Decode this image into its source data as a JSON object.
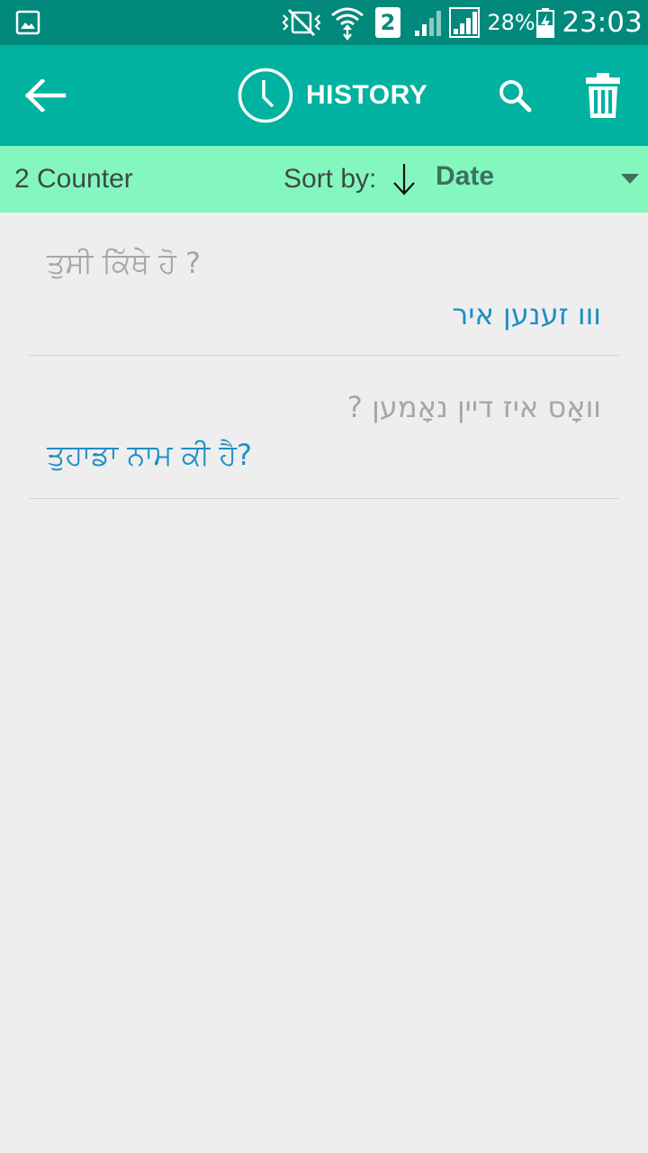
{
  "status_bar": {
    "battery_percent": "28%",
    "time": "23:03",
    "sim_badge": "2",
    "icons": [
      "gallery-notification-icon",
      "vibrate-mute-icon",
      "wifi-icon",
      "sim2-icon",
      "signal-1-icon",
      "signal-2-icon",
      "battery-charging-icon"
    ]
  },
  "toolbar": {
    "title": "HISTORY",
    "icons": [
      "back-arrow-icon",
      "clock-icon",
      "search-icon",
      "trash-icon"
    ],
    "color": "#00b29f"
  },
  "sort_bar": {
    "counter": "2 Counter",
    "sort_label": "Sort by:",
    "sort_value": "Date",
    "color": "#84f7bf"
  },
  "history": [
    {
      "source": "ਤੁਸੀ ਕਿੱਥੇ ਹੋ ?",
      "translation": "ווו זענען איר"
    },
    {
      "source": "וואָס איז דיין נאָמען ?",
      "translation": "ਤੁਹਾਡਾ ਨਾਮ ਕੀ ਹੈ?"
    }
  ],
  "colors": {
    "status_bar": "#01897b",
    "source_text": "#a6a6a6",
    "translation_text": "#1e8fc4",
    "background": "#eeeeee"
  }
}
